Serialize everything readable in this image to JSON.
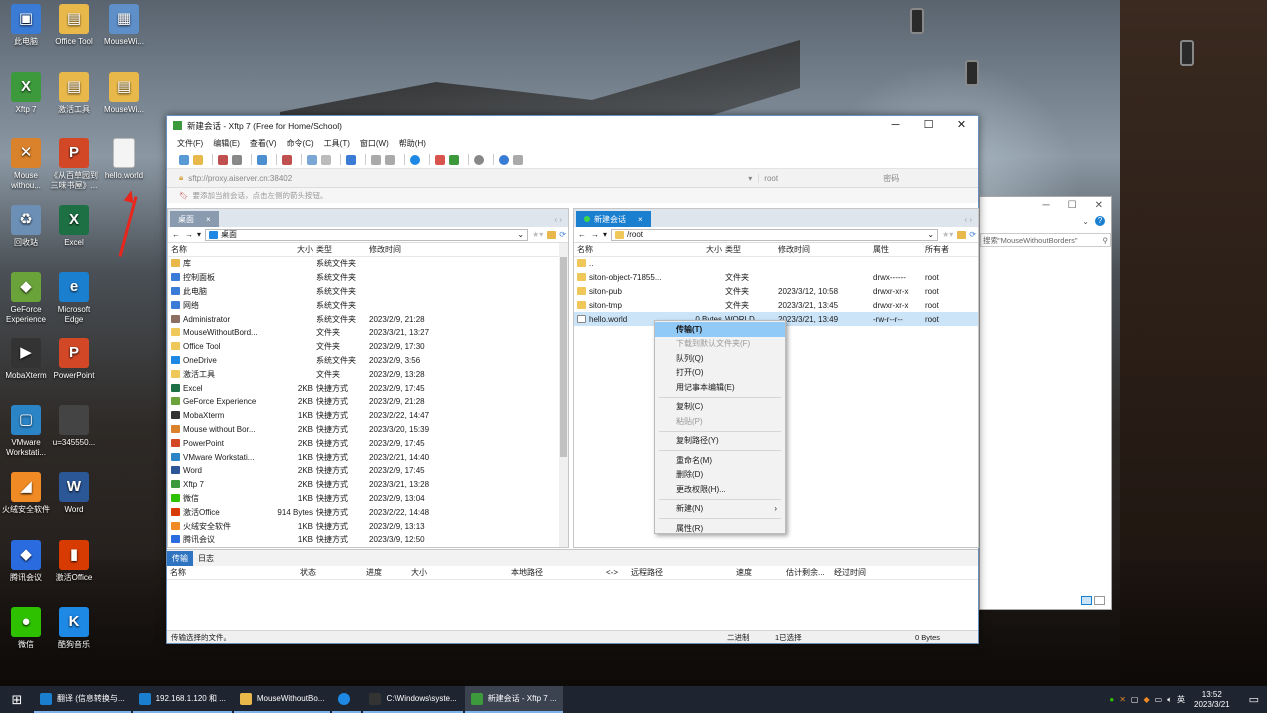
{
  "desktop": {
    "icons": [
      {
        "label": "此电脑",
        "color": "#3a7bd5",
        "glyph": "▣"
      },
      {
        "label": "Office Tool",
        "color": "#e8b84a",
        "glyph": "▤"
      },
      {
        "label": "MouseWi...",
        "color": "#5e8fc8",
        "glyph": "▦"
      },
      {
        "label": "Xftp 7",
        "color": "#3c9a3c",
        "glyph": "X"
      },
      {
        "label": "激活工具",
        "color": "#e8b84a",
        "glyph": "▤"
      },
      {
        "label": "MouseWi...",
        "color": "#e8b84a",
        "glyph": "▤"
      },
      {
        "label": "Mouse withou...",
        "color": "#d9822b",
        "glyph": "✕"
      },
      {
        "label": "《从百草园到三味书屋》...",
        "color": "#d24726",
        "glyph": "P"
      },
      {
        "label": "hello.world",
        "color": "#f4f4f4",
        "glyph": ""
      },
      {
        "label": "回收站",
        "color": "#6b8fb5",
        "glyph": "♻"
      },
      {
        "label": "Excel",
        "color": "#1d7044",
        "glyph": "X"
      },
      {
        "label": "GeForce Experience",
        "color": "#6aa33a",
        "glyph": "◆"
      },
      {
        "label": "Microsoft Edge",
        "color": "#1b7fd0",
        "glyph": "e"
      },
      {
        "label": "MobaXterm",
        "color": "#333",
        "glyph": "▶"
      },
      {
        "label": "PowerPoint",
        "color": "#d24726",
        "glyph": "P"
      },
      {
        "label": "VMware Workstati...",
        "color": "#2a84c6",
        "glyph": "▢"
      },
      {
        "label": "u=345550...",
        "color": "#444",
        "glyph": ""
      },
      {
        "label": "火绒安全软件",
        "color": "#f08a24",
        "glyph": "◢"
      },
      {
        "label": "Word",
        "color": "#2b5797",
        "glyph": "W"
      },
      {
        "label": "腾讯会议",
        "color": "#2b6be0",
        "glyph": "◆"
      },
      {
        "label": "激活Office",
        "color": "#d83b01",
        "glyph": "▮"
      },
      {
        "label": "微信",
        "color": "#2dc100",
        "glyph": "●"
      },
      {
        "label": "酷狗音乐",
        "color": "#1e88e5",
        "glyph": "K"
      }
    ]
  },
  "window": {
    "title": "新建会话 - Xftp 7 (Free for Home/School)",
    "menu": [
      "文件(F)",
      "编辑(E)",
      "查看(V)",
      "命令(C)",
      "工具(T)",
      "窗口(W)",
      "帮助(H)"
    ],
    "address": {
      "url": "sftp://proxy.aiserver.cn:38402",
      "user_placeholder": "root",
      "password_placeholder": "密码"
    },
    "hint": "要添加当前会话，点击左侧的箭头按钮。",
    "local": {
      "tab": "桌面",
      "path": "桌面",
      "columns": [
        "名称",
        "大小",
        "类型",
        "修改时间"
      ],
      "rows": [
        {
          "name": "库",
          "size": "",
          "type": "系统文件夹",
          "date": "",
          "color": "#e8b84a"
        },
        {
          "name": "控制面板",
          "size": "",
          "type": "系统文件夹",
          "date": "",
          "color": "#3a7bd5"
        },
        {
          "name": "此电脑",
          "size": "",
          "type": "系统文件夹",
          "date": "",
          "color": "#3a7bd5"
        },
        {
          "name": "网络",
          "size": "",
          "type": "系统文件夹",
          "date": "",
          "color": "#3a7bd5"
        },
        {
          "name": "Administrator",
          "size": "",
          "type": "系统文件夹",
          "date": "2023/2/9, 21:28",
          "color": "#8d6e63"
        },
        {
          "name": "MouseWithoutBord...",
          "size": "",
          "type": "文件夹",
          "date": "2023/3/21, 13:27",
          "color": "#f0c85a"
        },
        {
          "name": "Office Tool",
          "size": "",
          "type": "文件夹",
          "date": "2023/2/9, 17:30",
          "color": "#f0c85a"
        },
        {
          "name": "OneDrive",
          "size": "",
          "type": "系统文件夹",
          "date": "2023/2/9, 3:56",
          "color": "#1e88e5"
        },
        {
          "name": "激活工具",
          "size": "",
          "type": "文件夹",
          "date": "2023/2/9, 13:28",
          "color": "#f0c85a"
        },
        {
          "name": "Excel",
          "size": "2KB",
          "type": "快捷方式",
          "date": "2023/2/9, 17:45",
          "color": "#1d7044"
        },
        {
          "name": "GeForce Experience",
          "size": "2KB",
          "type": "快捷方式",
          "date": "2023/2/9, 21:28",
          "color": "#6aa33a"
        },
        {
          "name": "MobaXterm",
          "size": "1KB",
          "type": "快捷方式",
          "date": "2023/2/22, 14:47",
          "color": "#333"
        },
        {
          "name": "Mouse without Bor...",
          "size": "2KB",
          "type": "快捷方式",
          "date": "2023/3/20, 15:39",
          "color": "#d9822b"
        },
        {
          "name": "PowerPoint",
          "size": "2KB",
          "type": "快捷方式",
          "date": "2023/2/9, 17:45",
          "color": "#d24726"
        },
        {
          "name": "VMware Workstati...",
          "size": "1KB",
          "type": "快捷方式",
          "date": "2023/2/21, 14:40",
          "color": "#2a84c6"
        },
        {
          "name": "Word",
          "size": "2KB",
          "type": "快捷方式",
          "date": "2023/2/9, 17:45",
          "color": "#2b5797"
        },
        {
          "name": "Xftp 7",
          "size": "2KB",
          "type": "快捷方式",
          "date": "2023/3/21, 13:28",
          "color": "#3c9a3c"
        },
        {
          "name": "微信",
          "size": "1KB",
          "type": "快捷方式",
          "date": "2023/2/9, 13:04",
          "color": "#2dc100"
        },
        {
          "name": "激活Office",
          "size": "914 Bytes",
          "type": "快捷方式",
          "date": "2023/2/22, 14:48",
          "color": "#d83b01"
        },
        {
          "name": "火绒安全软件",
          "size": "1KB",
          "type": "快捷方式",
          "date": "2023/2/9, 13:13",
          "color": "#f08a24"
        },
        {
          "name": "腾讯会议",
          "size": "1KB",
          "type": "快捷方式",
          "date": "2023/3/9, 12:50",
          "color": "#2b6be0"
        }
      ]
    },
    "remote": {
      "tab": "新建会话",
      "path": "/root",
      "columns": [
        "名称",
        "大小",
        "类型",
        "修改时间",
        "属性",
        "所有者"
      ],
      "rows": [
        {
          "name": "..",
          "size": "",
          "type": "",
          "date": "",
          "attr": "",
          "owner": ""
        },
        {
          "name": "siton-object-71855...",
          "size": "",
          "type": "文件夹",
          "date": "",
          "attr": "drwx------",
          "owner": "root"
        },
        {
          "name": "siton-pub",
          "size": "",
          "type": "文件夹",
          "date": "2023/3/12, 10:58",
          "attr": "drwxr-xr-x",
          "owner": "root"
        },
        {
          "name": "siton-tmp",
          "size": "",
          "type": "文件夹",
          "date": "2023/3/21, 13:45",
          "attr": "drwxr-xr-x",
          "owner": "root"
        },
        {
          "name": "hello.world",
          "size": "0 Bytes",
          "type": "WORLD...",
          "date": "2023/3/21, 13:49",
          "attr": "-rw-r--r--",
          "owner": "root"
        }
      ]
    },
    "transfer": {
      "tabs": [
        "传输",
        "日志"
      ],
      "columns": [
        "名称",
        "状态",
        "进度",
        "大小",
        "本地路径",
        "<->",
        "远程路径",
        "速度",
        "估计剩余...",
        "经过时间"
      ]
    },
    "status": {
      "left": "传输选择的文件。",
      "mode": "二进制",
      "selected": "1已选择",
      "bytes": "0 Bytes"
    }
  },
  "context_menu": [
    {
      "label": "传输(T)",
      "state": "highlight"
    },
    {
      "label": "下载到默认文件夹(F)",
      "state": "disabled"
    },
    {
      "label": "队列(Q)",
      "state": "normal"
    },
    {
      "label": "打开(O)",
      "state": "normal"
    },
    {
      "label": "用记事本编辑(E)",
      "state": "normal"
    },
    {
      "sep": true
    },
    {
      "label": "复制(C)",
      "state": "normal"
    },
    {
      "label": "粘贴(P)",
      "state": "disabled"
    },
    {
      "sep": true
    },
    {
      "label": "复制路径(Y)",
      "state": "normal"
    },
    {
      "sep": true
    },
    {
      "label": "重命名(M)",
      "state": "normal"
    },
    {
      "label": "删除(D)",
      "state": "normal"
    },
    {
      "label": "更改权限(H)...",
      "state": "normal"
    },
    {
      "sep": true
    },
    {
      "label": "新建(N)",
      "state": "normal",
      "submenu": true
    },
    {
      "sep": true
    },
    {
      "label": "属性(R)",
      "state": "normal"
    }
  ],
  "background_window": {
    "search_placeholder": "搜索\"MouseWithoutBorders\""
  },
  "taskbar": {
    "tasks": [
      {
        "label": "翻译 (信息转换与...",
        "color": "#1b7fd0"
      },
      {
        "label": "192.168.1.120 和 ...",
        "color": "#1b7fd0"
      },
      {
        "label": "MouseWithoutBo...",
        "color": "#e8b84a"
      },
      {
        "label": "",
        "color": "#1e88e5"
      },
      {
        "label": "C:\\Windows\\syste...",
        "color": "#333"
      },
      {
        "label": "新建会话 - Xftp 7 ...",
        "color": "#3c9a3c"
      }
    ],
    "time": "13:52",
    "date": "2023/3/21",
    "lang": "英"
  }
}
